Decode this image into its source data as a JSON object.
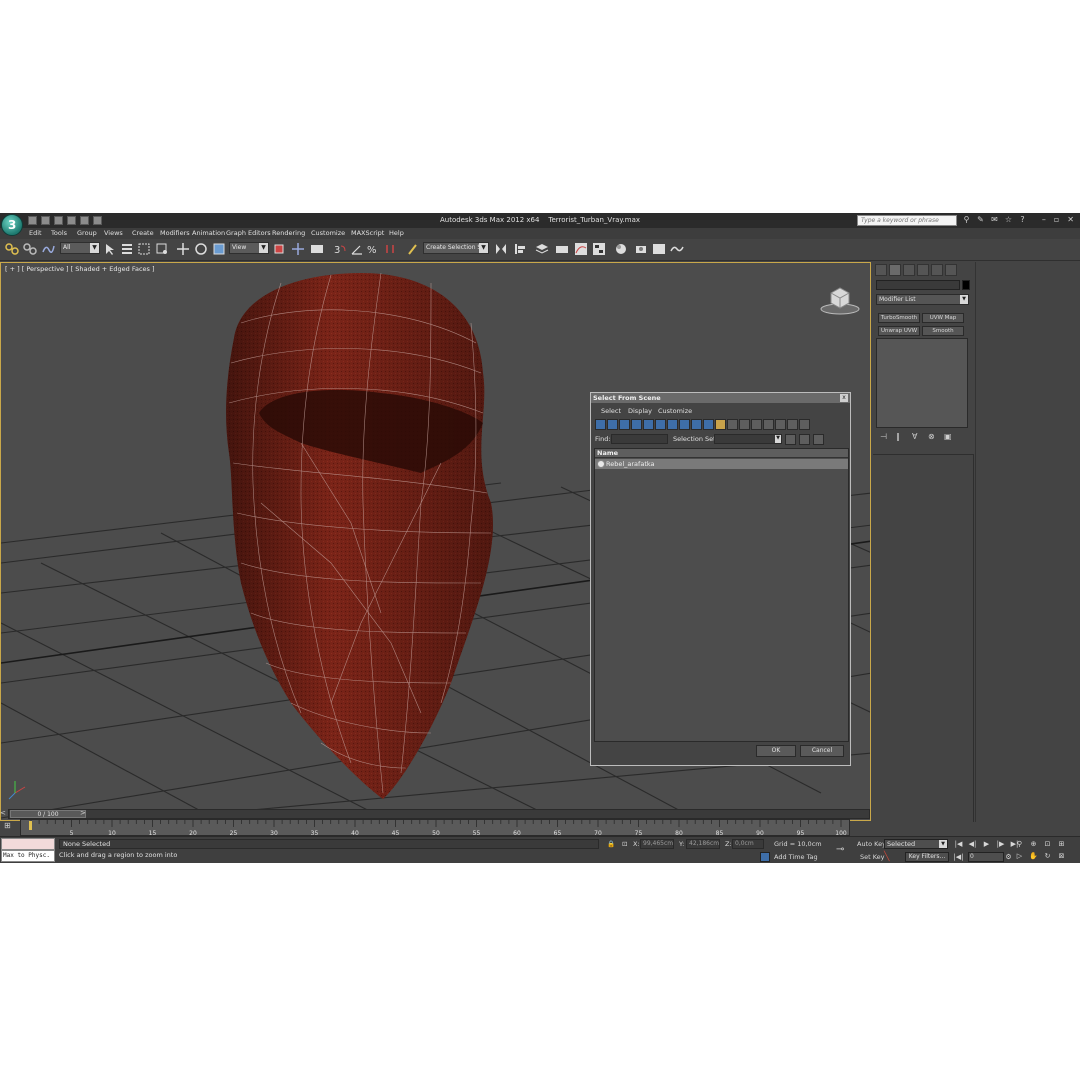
{
  "app": {
    "logo_glyph": "3",
    "title_app": "Autodesk 3ds Max  2012 x64",
    "title_file": "Terrorist_Turban_Vray.max",
    "search_placeholder": "Type a keyword or phrase"
  },
  "menu": [
    "Edit",
    "Tools",
    "Group",
    "Views",
    "Create",
    "Modifiers",
    "Animation",
    "Graph Editors",
    "Rendering",
    "Customize",
    "MAXScript",
    "Help"
  ],
  "toolbar": {
    "filter_value": "All",
    "ref_coord_value": "View",
    "selection_set_value": "Create Selection Se"
  },
  "viewport": {
    "label": "[ + ] [ Perspective ] [ Shaded + Edged Faces ]",
    "mesh_color": "#7a2418"
  },
  "command_panel": {
    "modifier_list": "Modifier List",
    "buttons": [
      "TurboSmooth",
      "UVW Map",
      "Unwrap UVW",
      "Smooth"
    ]
  },
  "dialog": {
    "title": "Select From Scene",
    "close": "x",
    "menu": [
      "Select",
      "Display",
      "Customize"
    ],
    "find_label": "Find:",
    "selection_set_label": "Selection Set:",
    "column_name": "Name",
    "rows": [
      "Rebel_arafatka"
    ],
    "ok_label": "OK",
    "cancel_label": "Cancel"
  },
  "timeline": {
    "frame_display": "0 / 100",
    "prev": "<",
    "next": ">",
    "ticks": [
      "0",
      "5",
      "10",
      "15",
      "20",
      "25",
      "30",
      "35",
      "40",
      "45",
      "50",
      "55",
      "60",
      "65",
      "70",
      "75",
      "80",
      "85",
      "90",
      "95",
      "100"
    ]
  },
  "status": {
    "maxscript_line": "Max to Physc.",
    "selection": "None Selected",
    "prompt": "Click and drag a region to zoom into",
    "x_label": "X:",
    "x_value": "99,465cm",
    "y_label": "Y:",
    "y_value": "42,186cm",
    "z_label": "Z:",
    "z_value": "0,0cm",
    "grid": "Grid = 10,0cm",
    "add_time_tag": "Add Time Tag",
    "auto_key": "Auto Key",
    "set_key": "Set Key",
    "selected_dropdown": "Selected",
    "key_filters": "Key Filters...",
    "frame_field": "0"
  }
}
